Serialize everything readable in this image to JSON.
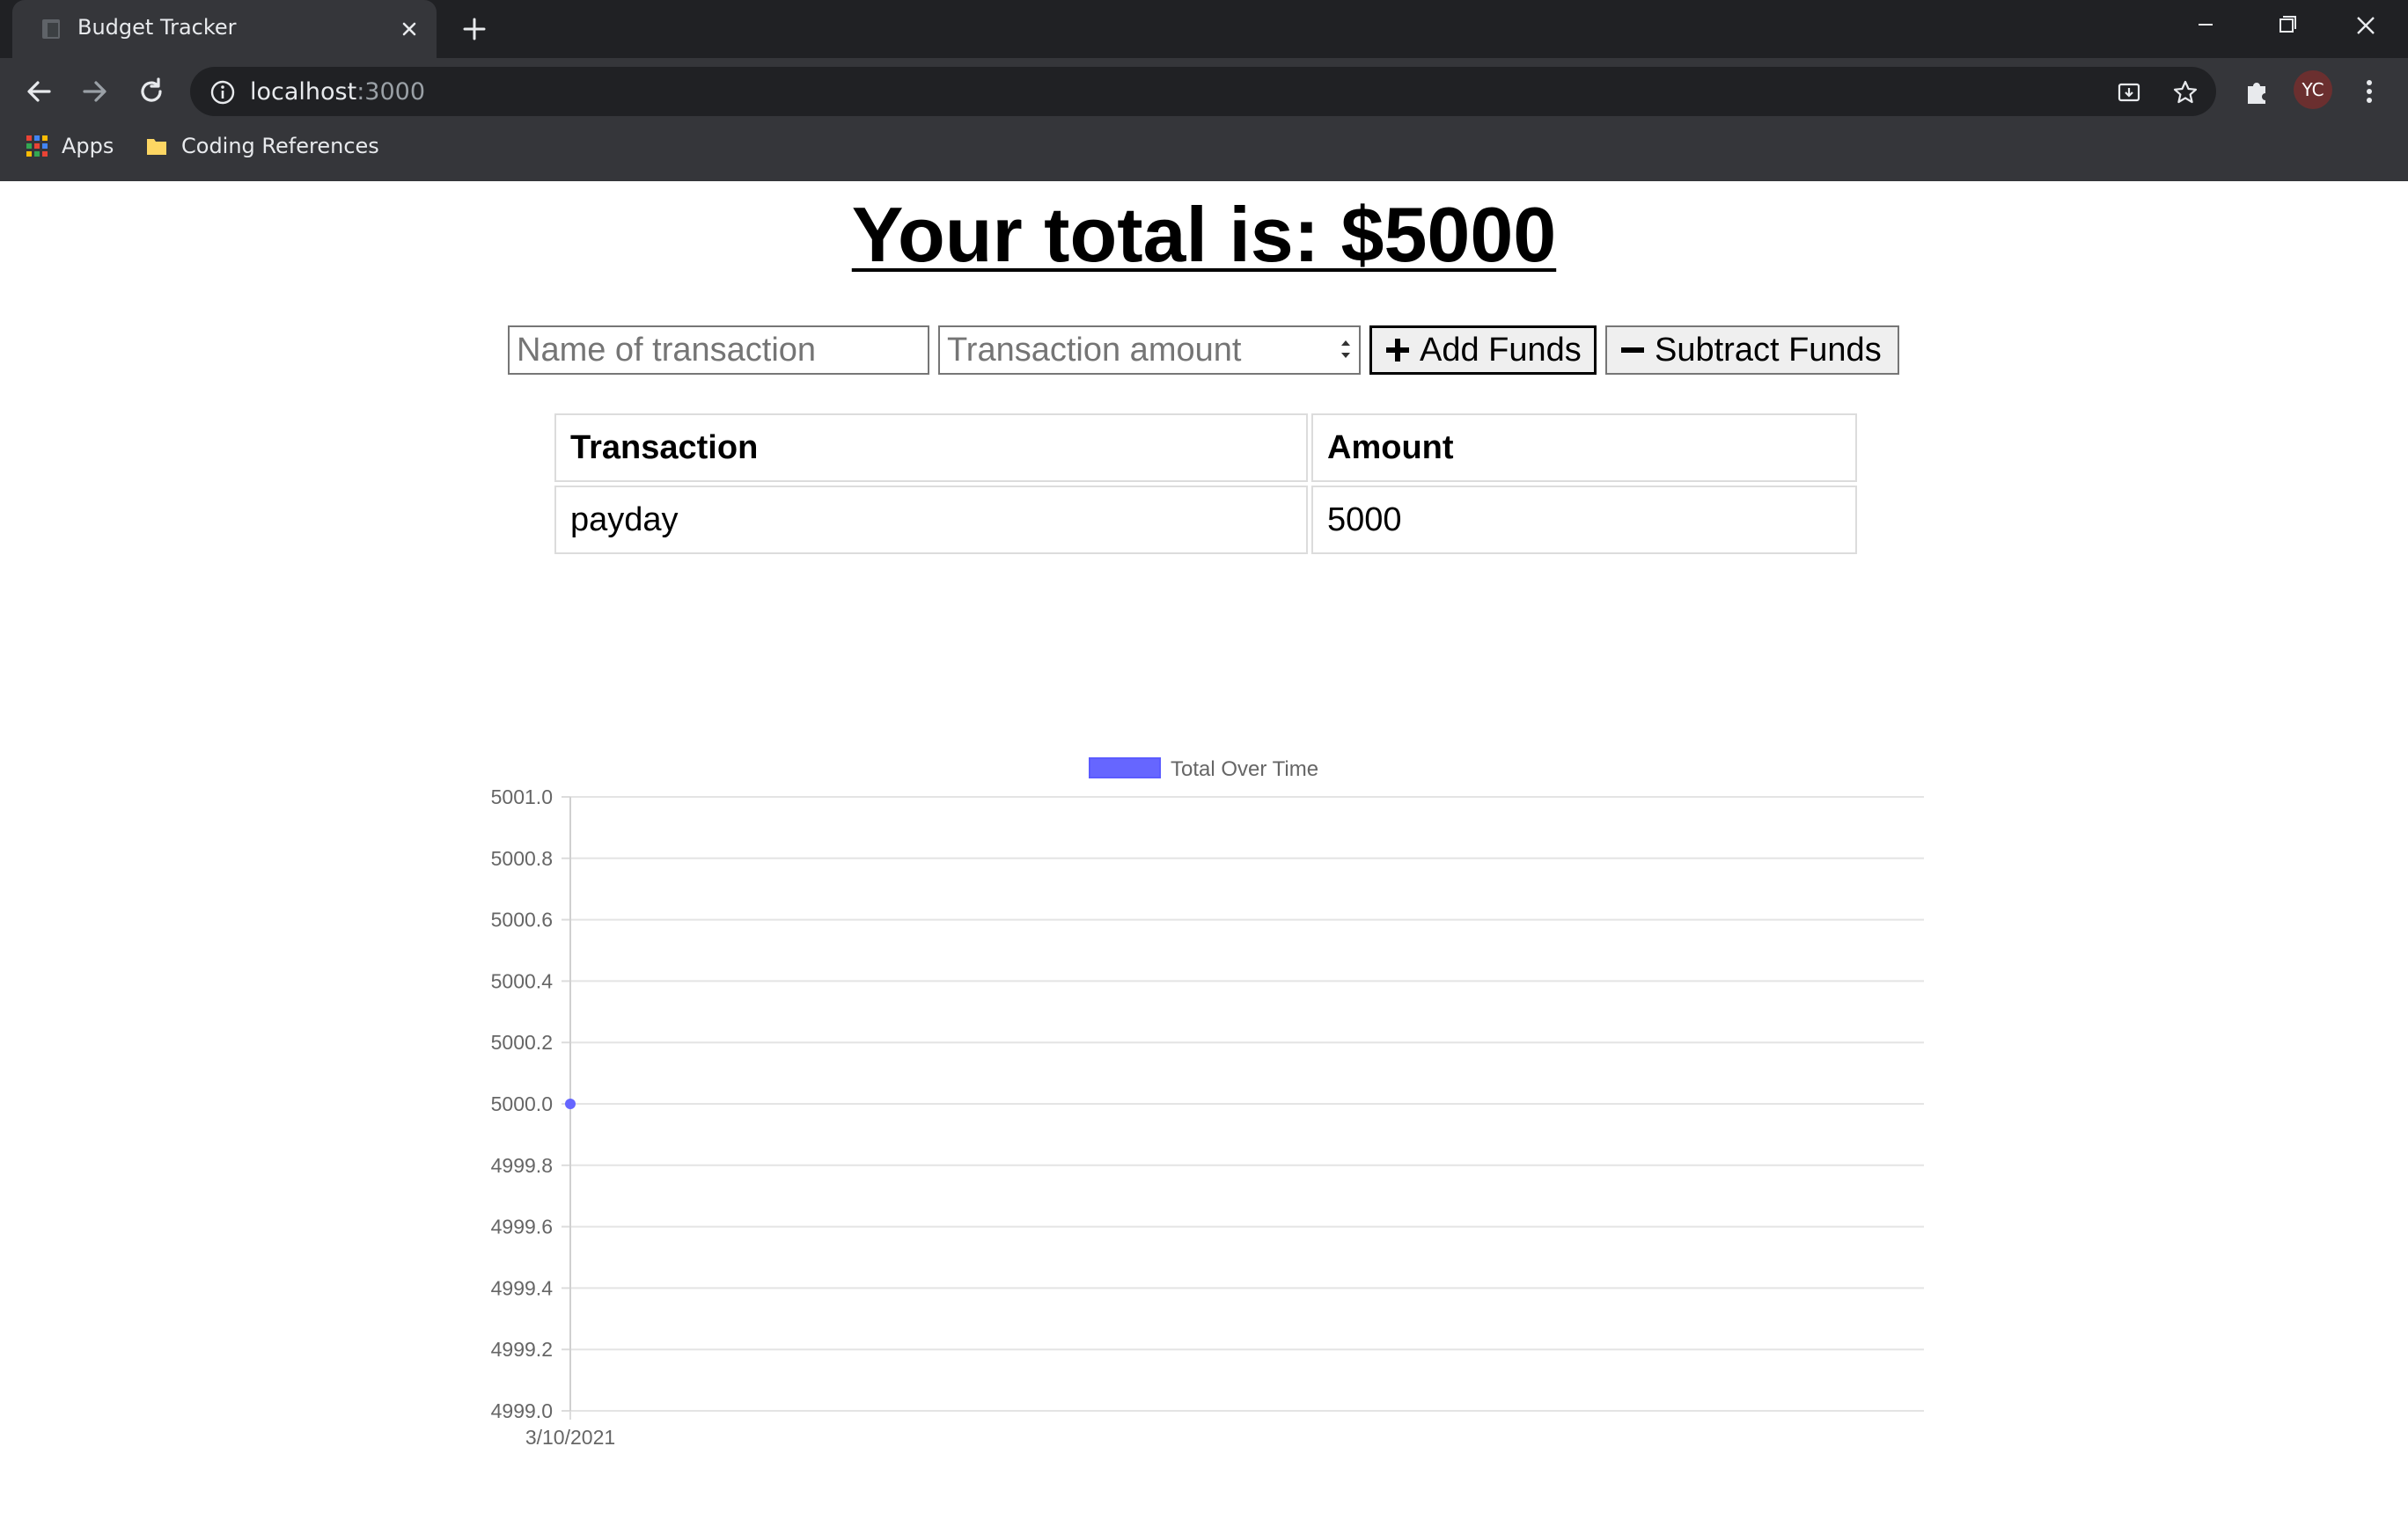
{
  "browser": {
    "tab_title": "Budget Tracker",
    "url_host": "localhost",
    "url_port": ":3000",
    "profile_initials": "YC",
    "bookmarks": [
      {
        "label": "Apps",
        "icon": "apps-grid-icon"
      },
      {
        "label": "Coding References",
        "icon": "folder-icon"
      }
    ]
  },
  "page": {
    "total_text": "Your total is: $5000",
    "name_placeholder": "Name of transaction",
    "amount_placeholder": "Transaction amount",
    "add_label": "Add Funds",
    "subtract_label": "Subtract Funds",
    "table": {
      "headers": [
        "Transaction",
        "Amount"
      ],
      "rows": [
        [
          "payday",
          "5000"
        ]
      ]
    }
  },
  "chart_data": {
    "type": "line",
    "x": [
      "3/10/2021"
    ],
    "series": [
      {
        "name": "Total Over Time",
        "values": [
          5000
        ],
        "color": "#6666ff"
      }
    ],
    "yticks": [
      "5001.0",
      "5000.8",
      "5000.6",
      "5000.4",
      "5000.2",
      "5000.0",
      "4999.8",
      "4999.6",
      "4999.4",
      "4999.2",
      "4999.0"
    ],
    "ylim": [
      4999.0,
      5001.0
    ],
    "grid": true,
    "legend": "top"
  }
}
